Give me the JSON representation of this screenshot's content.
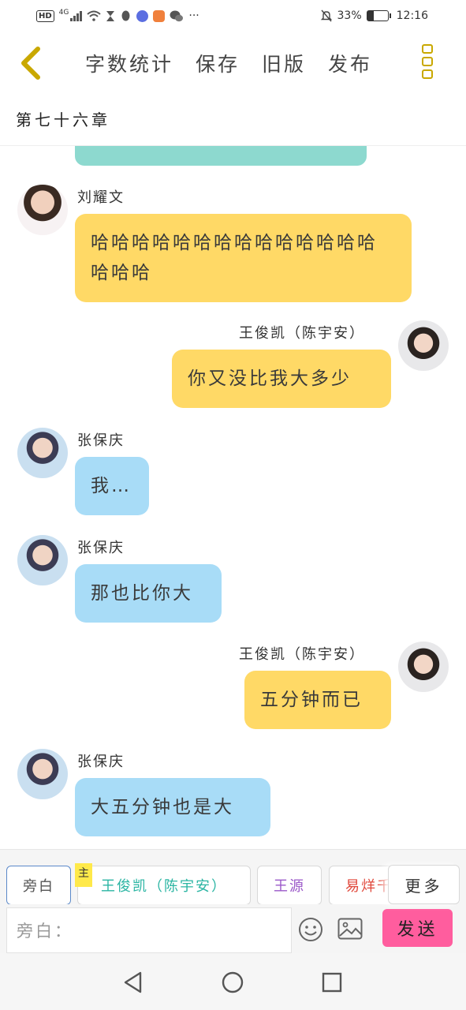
{
  "status_bar": {
    "hd": "HD",
    "network": "4G",
    "battery_text": "33%",
    "battery_level": 0.33,
    "time": "12:16",
    "overflow": "···"
  },
  "nav": {
    "back_icon": "chevron-left-icon",
    "actions": [
      "字数统计",
      "保存",
      "旧版",
      "发布"
    ],
    "menu_icon": "more-vertical-icon"
  },
  "chapter": {
    "title": "第七十六章"
  },
  "messages": [
    {
      "side": "left",
      "sender": "刘耀文",
      "text": "哈哈哈哈哈哈哈哈哈哈哈哈哈哈哈哈哈",
      "color": "#ffd966"
    },
    {
      "side": "right",
      "sender": "王俊凯（陈宇安）",
      "text": "你又没比我大多少",
      "color": "#ffd966"
    },
    {
      "side": "left",
      "sender": "张保庆",
      "text": "我…",
      "color": "#a8dcf7"
    },
    {
      "side": "left",
      "sender": "张保庆",
      "text": "那也比你大",
      "color": "#a8dcf7"
    },
    {
      "side": "right",
      "sender": "王俊凯（陈宇安）",
      "text": "五分钟而已",
      "color": "#ffd966"
    },
    {
      "side": "left",
      "sender": "张保庆",
      "text": "大五分钟也是大",
      "color": "#a8dcf7"
    }
  ],
  "characters": {
    "items": [
      {
        "label": "旁白",
        "color": "#555555"
      },
      {
        "label": "王俊凯（陈宇安）",
        "color": "#2bb5a3"
      },
      {
        "label": "王源",
        "color": "#9b59c9"
      },
      {
        "label": "易烊千玺",
        "color": "#e0473a"
      }
    ],
    "main_tag": "主",
    "more_label": "更多"
  },
  "input": {
    "placeholder": "旁白：",
    "send_label": "发送",
    "emoji_icon": "smiley-icon",
    "image_icon": "image-icon"
  },
  "system_nav": [
    "back-triangle-icon",
    "home-circle-icon",
    "recents-square-icon"
  ],
  "colors": {
    "accent_yellow": "#c9a800",
    "bubble_yellow": "#ffd966",
    "bubble_blue": "#a8dcf7",
    "bubble_teal": "#8dd9cf",
    "send_pink": "#ff5d9e"
  }
}
